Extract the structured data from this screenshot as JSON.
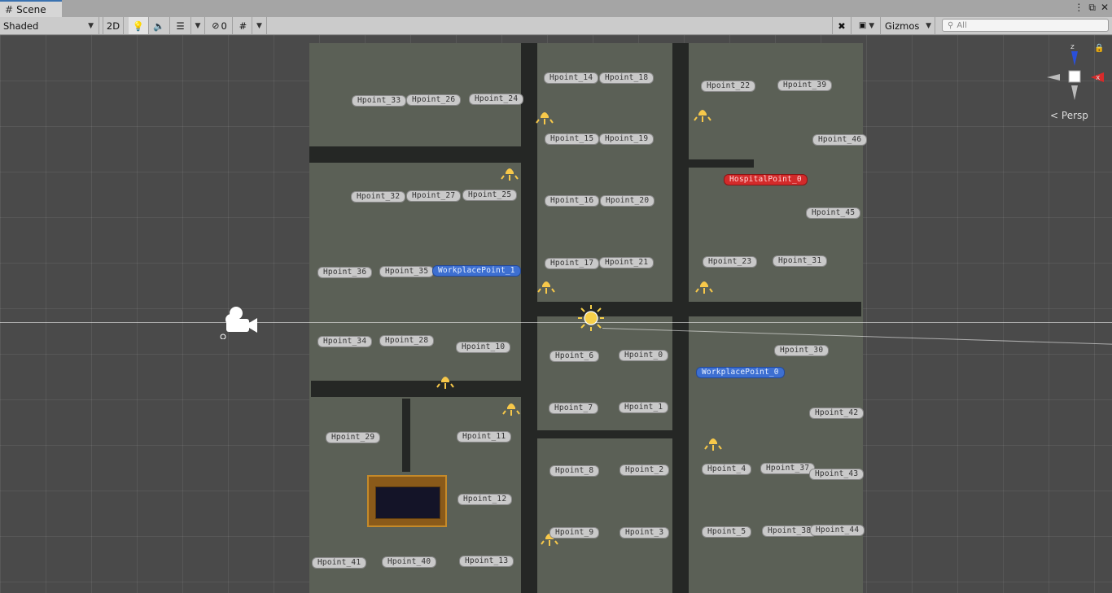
{
  "tab": {
    "title": "Scene"
  },
  "toolbar": {
    "shading_mode": "Shaded",
    "mode_2d": "2D",
    "hidden_count": "0",
    "gizmos": "Gizmos",
    "search_placeholder": "All"
  },
  "gizmo": {
    "axis_x": "x",
    "axis_z": "z",
    "projection": "Persp"
  },
  "labels": {
    "hp33": "Hpoint_33",
    "hp26": "Hpoint_26",
    "hp24": "Hpoint_24",
    "hp14": "Hpoint_14",
    "hp18": "Hpoint_18",
    "hp22": "Hpoint_22",
    "hp39": "Hpoint_39",
    "hp15": "Hpoint_15",
    "hp19": "Hpoint_19",
    "hp46": "Hpoint_46",
    "hospital0": "HospitalPoint_0",
    "hp32": "Hpoint_32",
    "hp27": "Hpoint_27",
    "hp25": "Hpoint_25",
    "hp16": "Hpoint_16",
    "hp20": "Hpoint_20",
    "hp45": "Hpoint_45",
    "hp36": "Hpoint_36",
    "hp35": "Hpoint_35",
    "work1": "WorkplacePoint_1",
    "hp17": "Hpoint_17",
    "hp21": "Hpoint_21",
    "hp23": "Hpoint_23",
    "hp31": "Hpoint_31",
    "hp34": "Hpoint_34",
    "hp28": "Hpoint_28",
    "hp10": "Hpoint_10",
    "hp6": "Hpoint_6",
    "hp0": "Hpoint_0",
    "hp30": "Hpoint_30",
    "work0": "WorkplacePoint_0",
    "hp7": "Hpoint_7",
    "hp1": "Hpoint_1",
    "hp42": "Hpoint_42",
    "hp29": "Hpoint_29",
    "hp11": "Hpoint_11",
    "hp8": "Hpoint_8",
    "hp2": "Hpoint_2",
    "hp4": "Hpoint_4",
    "hp37": "Hpoint_37",
    "hp43": "Hpoint_43",
    "hp12": "Hpoint_12",
    "hp9": "Hpoint_9",
    "hp3": "Hpoint_3",
    "hp5": "Hpoint_5",
    "hp38": "Hpoint_38",
    "hp44": "Hpoint_44",
    "hp41": "Hpoint_41",
    "hp40": "Hpoint_40",
    "hp13": "Hpoint_13"
  },
  "colors": {
    "hospital": "#d32a2a",
    "workplace": "#3d6fd1",
    "ground": "#5b6056",
    "road": "#252725"
  }
}
